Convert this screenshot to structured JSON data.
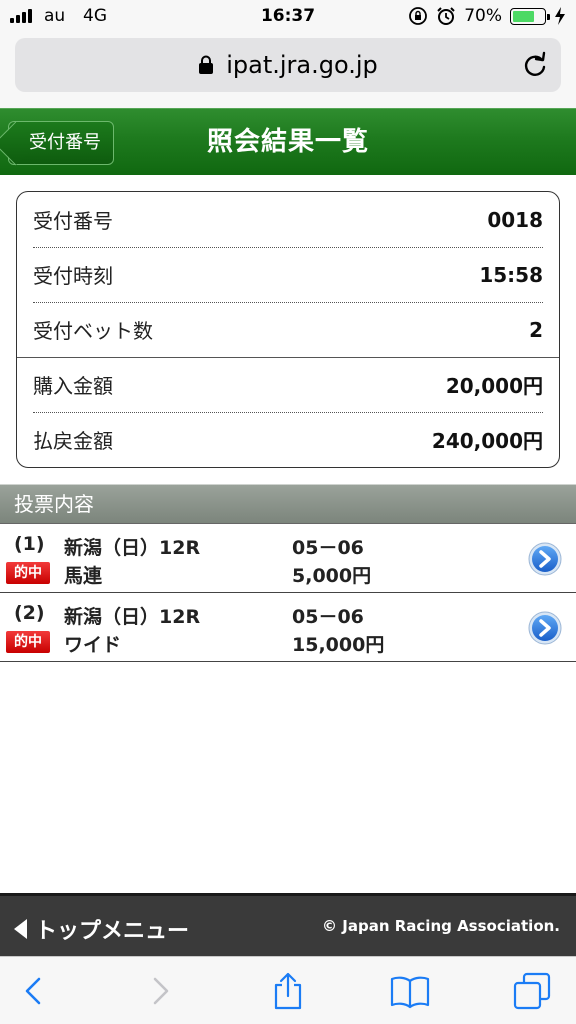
{
  "status_bar": {
    "carrier": "au",
    "network": "4G",
    "time": "16:37",
    "battery": "70%",
    "battery_level": 0.7
  },
  "browser": {
    "url": "ipat.jra.go.jp"
  },
  "header": {
    "back_label": "受付番号",
    "title": "照会結果一覧"
  },
  "summary": {
    "rows": [
      {
        "label": "受付番号",
        "value": "0018"
      },
      {
        "label": "受付時刻",
        "value": "15:58"
      },
      {
        "label": "受付ベット数",
        "value": "2"
      },
      {
        "label": "購入金額",
        "value": "20,000円"
      },
      {
        "label": "払戻金額",
        "value": "240,000円"
      }
    ]
  },
  "bets_section": {
    "title": "投票内容",
    "items": [
      {
        "number": "(1)",
        "race": "新潟（日）12R",
        "combination": "05－06",
        "result_badge": "的中",
        "bet_type": "馬連",
        "amount": "5,000円"
      },
      {
        "number": "(2)",
        "race": "新潟（日）12R",
        "combination": "05－06",
        "result_badge": "的中",
        "bet_type": "ワイド",
        "amount": "15,000円"
      }
    ]
  },
  "footer": {
    "top_menu_label": "トップメニュー",
    "copyright": "© Japan Racing Association."
  },
  "colors": {
    "header_green": "#1e7a1e",
    "hit_red": "#d60000",
    "detail_blue": "#1e6fd9"
  }
}
